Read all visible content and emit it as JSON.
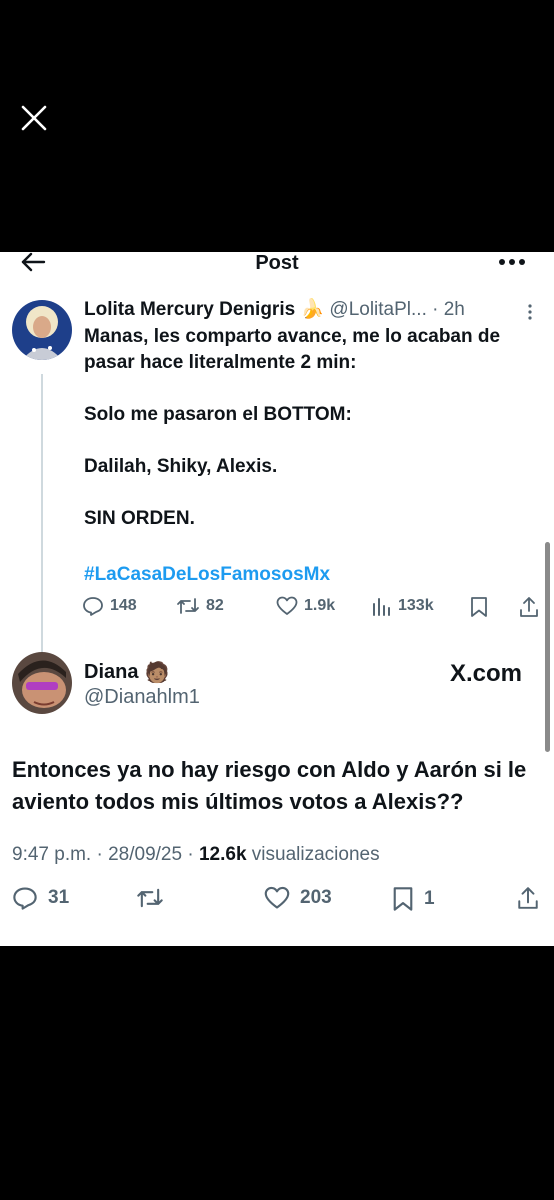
{
  "header": {
    "title": "Post"
  },
  "quoted_post": {
    "author_name": "Lolita Mercury Denigris",
    "author_emoji": "🍌",
    "handle_time": "@LolitaPl... · 2h",
    "lines": [
      "Manas, les comparto avance, me lo acaban de pasar hace literalmente 2 min:",
      "Solo me pasaron el BOTTOM:",
      "Dalilah, Shiky, Alexis.",
      "SIN ORDEN."
    ],
    "hashtag": "#LaCasaDeLosFamososMx",
    "stats": {
      "replies": "148",
      "reposts": "82",
      "likes": "1.9k",
      "views": "133k"
    }
  },
  "reply_post": {
    "author_name": "Diana",
    "author_emoji": "🧑🏽",
    "handle": "@Dianahlm1",
    "watermark": "X.com",
    "text": "Entonces ya no hay riesgo con Aldo y Aarón si le aviento todos mis últimos votos a Alexis??",
    "meta": {
      "time": "9:47 p.m.",
      "date": "28/09/25",
      "views_count": "12.6k",
      "views_label": "visualizaciones"
    },
    "stats": {
      "replies": "31",
      "likes": "203",
      "bookmarks": "1"
    }
  },
  "colors": {
    "link": "#1d9bf0",
    "secondary_text": "#536471",
    "primary_text": "#0f1419"
  }
}
